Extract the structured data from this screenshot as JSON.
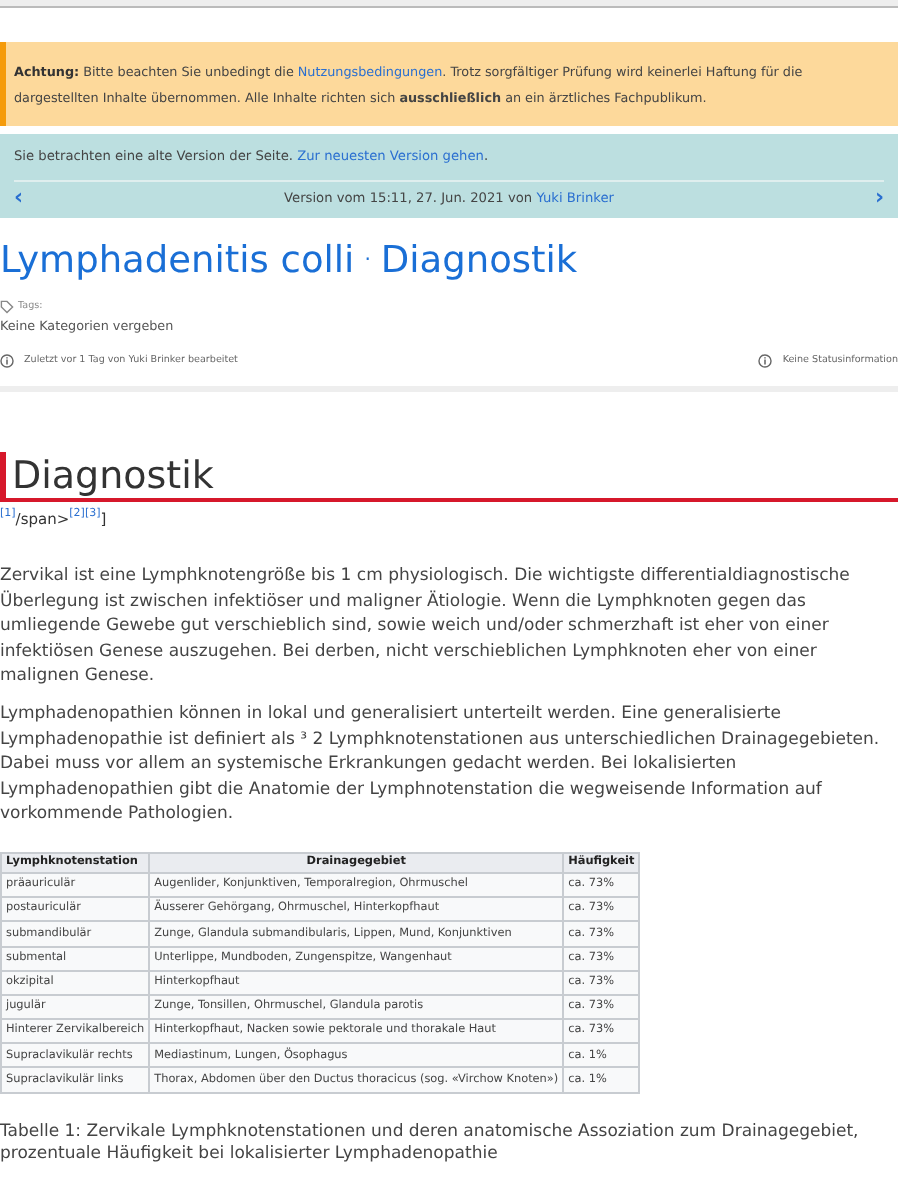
{
  "notice": {
    "label": "Achtung:",
    "parts": [
      {
        "kind": "text",
        "text": "Bitte beachten Sie unbedingt die "
      },
      {
        "kind": "link",
        "text": "Nutzungsbedingungen"
      },
      {
        "kind": "text",
        "text": ". Trotz sorgfältiger Prüfung wird keinerlei Haftung für die dargestellten Inhalte übernommen. Alle Inhalte richten sich "
      },
      {
        "kind": "bold",
        "text": "ausschließlich"
      },
      {
        "kind": "text",
        "text": " an ein ärztliches Fachpublikum."
      }
    ]
  },
  "version_box": {
    "message": "Sie betrachten eine alte Version der Seite.",
    "link": "Zur neuesten Version gehen",
    "period": ".",
    "prev": "‹",
    "next": "›",
    "version_text": "Version vom 15:11, 27. Jun. 2021 von",
    "author": "Yuki Brinker"
  },
  "title": {
    "parts": [
      "Lymphadenitis colli",
      "Diagnostik"
    ],
    "separator": "‧"
  },
  "tags": {
    "label": "Tags:",
    "value": "Keine Kategorien vergeben"
  },
  "meta": {
    "edited": "Zuletzt vor 1 Tag von Yuki Brinker bearbeitet",
    "status": "Keine Statusinformation"
  },
  "heading": "Diagnostik",
  "refs": [
    {
      "kind": "ref",
      "text": "[1]"
    },
    {
      "kind": "text",
      "text": "/span>"
    },
    {
      "kind": "ref",
      "text": "[2]"
    },
    {
      "kind": "ref",
      "text": "[3]"
    },
    {
      "kind": "text",
      "text": "]"
    }
  ],
  "paragraphs": [
    "Zervikal ist eine Lymphknotengröße bis 1 cm physiologisch. Die wichtigste differentialdiagnostische Überlegung ist zwischen infektiöser und maligner Ätiologie.  Wenn die Lymphknoten gegen das umliegende Gewebe gut verschieblich sind, sowie weich und/oder schmerzhaft ist eher von einer infektiösen Genese auszugehen. Bei derben, nicht verschieblichen Lymphknoten eher von einer malignen Genese.",
    "Lymphadenopathien können in lokal und generalisiert unterteilt werden. Eine generalisierte Lymphadenopathie ist definiert als ³ 2 Lymphknotenstationen aus unterschiedlichen Drainagegebieten. Dabei muss vor allem an systemische Erkrankungen gedacht werden. Bei lokalisierten Lymphadenopathien gibt die Anatomie der Lymphnotenstation die wegweisende Information auf vorkommende Pathologien."
  ],
  "table": {
    "columns": [
      "Lymphknotenstation",
      "Drainagegebiet",
      "Häufigkeit"
    ],
    "rows": [
      [
        "präauriculär",
        "Augenlider, Konjunktiven, Temporalregion, Ohrmuschel",
        "ca. 73%"
      ],
      [
        "postauriculär",
        "Äusserer Gehörgang, Ohrmuschel, Hinterkopfhaut",
        "ca. 73%"
      ],
      [
        "submandibulär",
        "Zunge, Glandula submandibularis, Lippen, Mund, Konjunktiven",
        "ca. 73%"
      ],
      [
        "submental",
        "Unterlippe, Mundboden, Zungenspitze, Wangenhaut",
        "ca. 73%"
      ],
      [
        "okzipital",
        "Hinterkopfhaut",
        "ca. 73%"
      ],
      [
        "jugulär",
        "Zunge, Tonsillen, Ohrmuschel, Glandula parotis",
        "ca. 73%"
      ],
      [
        "Hinterer Zervikalbereich",
        "Hinterkopfhaut, Nacken sowie pektorale und thorakale Haut",
        "ca. 73%"
      ],
      [
        "Supraclavikulär rechts",
        "Mediastinum, Lungen, Ösophagus",
        "ca. 1%"
      ],
      [
        "Supraclavikulär links",
        "Thorax, Abdomen über den Ductus thoracicus (sog. «Virchow Knoten»)",
        "ca. 1%"
      ]
    ]
  },
  "caption": "Tabelle 1: Zervikale Lymphknotenstationen und deren anatomische Assoziation zum Drainagegebiet, prozentuale Häufigkeit bei lokalisierter Lymphadenopathie"
}
